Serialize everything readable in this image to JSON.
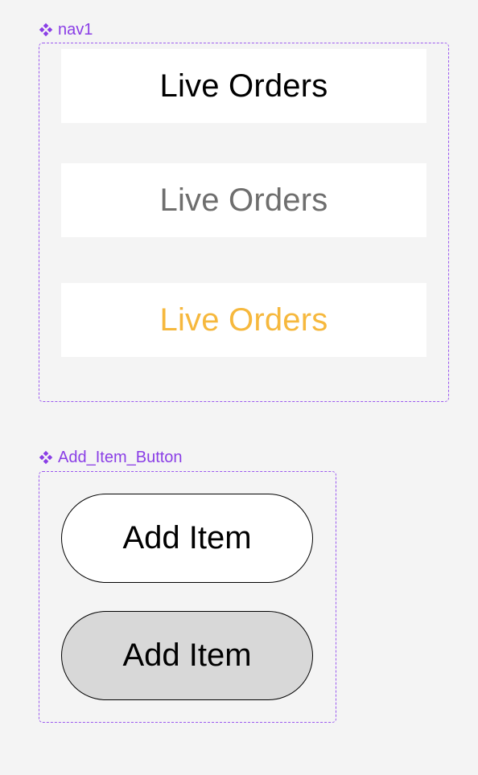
{
  "components": {
    "nav": {
      "label": "nav1",
      "icon": "component-diamond-icon",
      "items": [
        {
          "label": "Live Orders",
          "state": "default",
          "color": "#000000"
        },
        {
          "label": "Live Orders",
          "state": "muted",
          "color": "#6e6e6e"
        },
        {
          "label": "Live Orders",
          "state": "active",
          "color": "#f6b83d"
        }
      ]
    },
    "add_item_button": {
      "label": "Add_Item_Button",
      "icon": "component-diamond-icon",
      "variants": [
        {
          "label": "Add Item",
          "state": "default",
          "background": "#ffffff"
        },
        {
          "label": "Add Item",
          "state": "pressed",
          "background": "#d8d8d8"
        }
      ]
    }
  },
  "colors": {
    "canvas_background": "#f4f4f4",
    "component_accent": "#8a3ee6",
    "frame_border": "#9b59ef"
  }
}
